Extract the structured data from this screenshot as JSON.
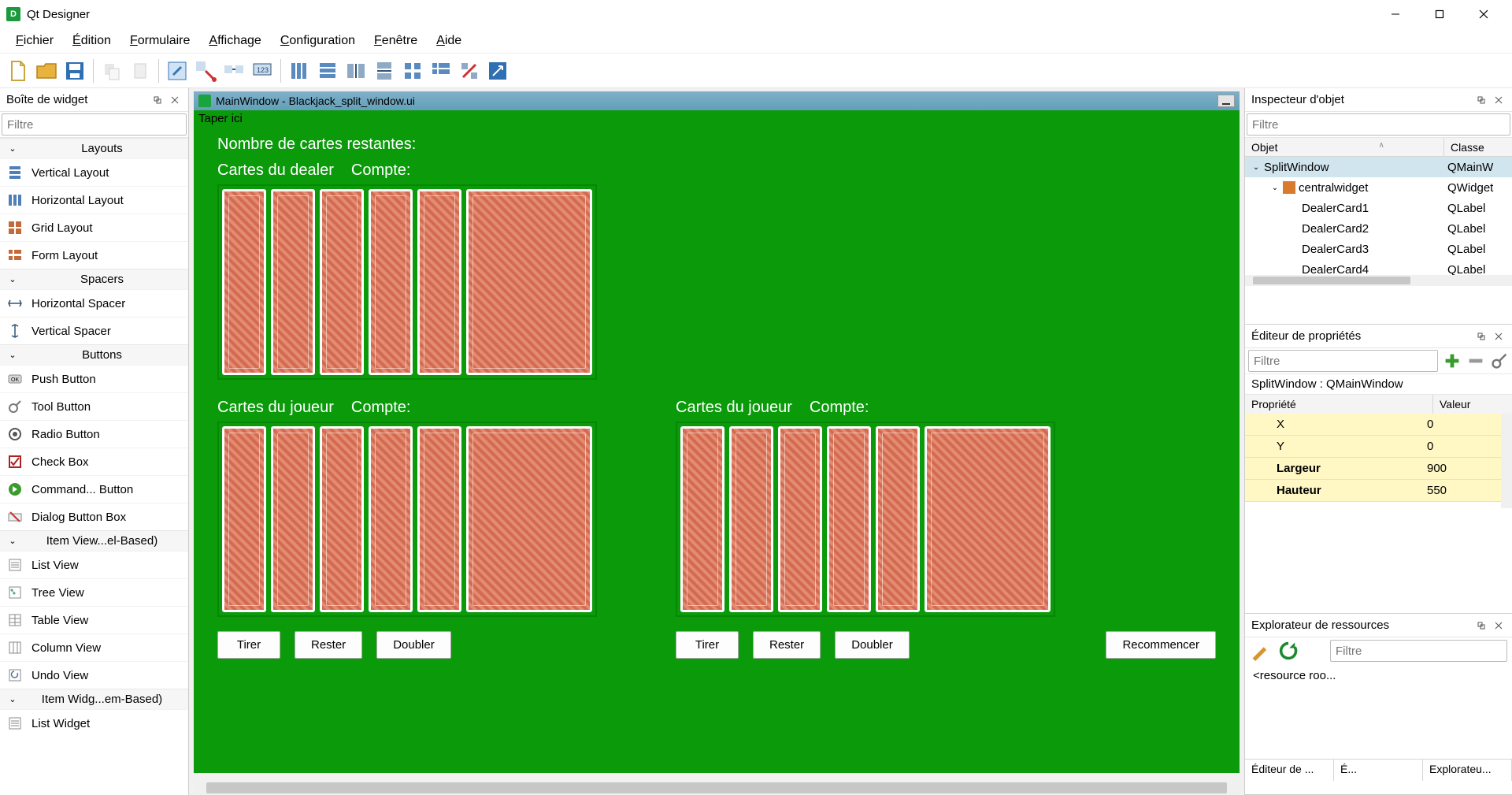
{
  "titlebar": {
    "app_name": "Qt Designer",
    "icon_letter": "D"
  },
  "menubar": {
    "items": [
      {
        "u": "F",
        "rest": "ichier"
      },
      {
        "u": "É",
        "rest": "dition"
      },
      {
        "u": "F",
        "rest": "ormulaire"
      },
      {
        "u": "A",
        "rest": "ffichage"
      },
      {
        "u": "C",
        "rest": "onfiguration"
      },
      {
        "u": "F",
        "rest": "enêtre"
      },
      {
        "u": "A",
        "rest": "ide"
      }
    ]
  },
  "widget_box": {
    "title": "Boîte de widget",
    "filter_placeholder": "Filtre",
    "categories": [
      {
        "name": "Layouts",
        "items": [
          "Vertical Layout",
          "Horizontal Layout",
          "Grid Layout",
          "Form Layout"
        ]
      },
      {
        "name": "Spacers",
        "items": [
          "Horizontal Spacer",
          "Vertical Spacer"
        ]
      },
      {
        "name": "Buttons",
        "items": [
          "Push Button",
          "Tool Button",
          "Radio Button",
          "Check Box",
          "Command... Button",
          "Dialog Button Box"
        ]
      },
      {
        "name": "Item View...el-Based)",
        "items": [
          "List View",
          "Tree View",
          "Table View",
          "Column View",
          "Undo View"
        ]
      },
      {
        "name": "Item Widg...em-Based)",
        "items": [
          "List Widget"
        ]
      }
    ]
  },
  "form": {
    "window_title": "MainWindow - Blackjack_split_window.ui",
    "menubar_hint": "Taper ici",
    "remaining_label": "Nombre de cartes restantes:",
    "dealer_label": "Cartes du dealer",
    "count_label": "Compte:",
    "player_label": "Cartes du joueur",
    "buttons": {
      "hit": "Tirer",
      "stay": "Rester",
      "double": "Doubler",
      "restart": "Recommencer"
    }
  },
  "object_inspector": {
    "title": "Inspecteur d'objet",
    "filter_placeholder": "Filtre",
    "col_object": "Objet",
    "col_class": "Classe",
    "rows": [
      {
        "indent": 0,
        "twist": "⌄",
        "name": "SplitWindow",
        "cls": "QMainW",
        "sel": true
      },
      {
        "indent": 1,
        "twist": "⌄",
        "name": "centralwidget",
        "cls": "QWidget",
        "icon": true
      },
      {
        "indent": 2,
        "twist": "",
        "name": "DealerCard1",
        "cls": "QLabel"
      },
      {
        "indent": 2,
        "twist": "",
        "name": "DealerCard2",
        "cls": "QLabel"
      },
      {
        "indent": 2,
        "twist": "",
        "name": "DealerCard3",
        "cls": "QLabel"
      },
      {
        "indent": 2,
        "twist": "",
        "name": "DealerCard4",
        "cls": "QLabel"
      }
    ]
  },
  "property_editor": {
    "title": "Éditeur de propriétés",
    "filter_placeholder": "Filtre",
    "object_line": "SplitWindow : QMainWindow",
    "col_prop": "Propriété",
    "col_val": "Valeur",
    "rows": [
      {
        "name": "X",
        "value": "0"
      },
      {
        "name": "Y",
        "value": "0"
      },
      {
        "name": "Largeur",
        "value": "900",
        "bold": true
      },
      {
        "name": "Hauteur",
        "value": "550",
        "bold": true
      }
    ]
  },
  "resource_explorer": {
    "title": "Explorateur de ressources",
    "filter_placeholder": "Filtre",
    "root_label": "<resource roo...",
    "tabs": [
      "Éditeur de ...",
      "É...",
      "Explorateu..."
    ]
  }
}
